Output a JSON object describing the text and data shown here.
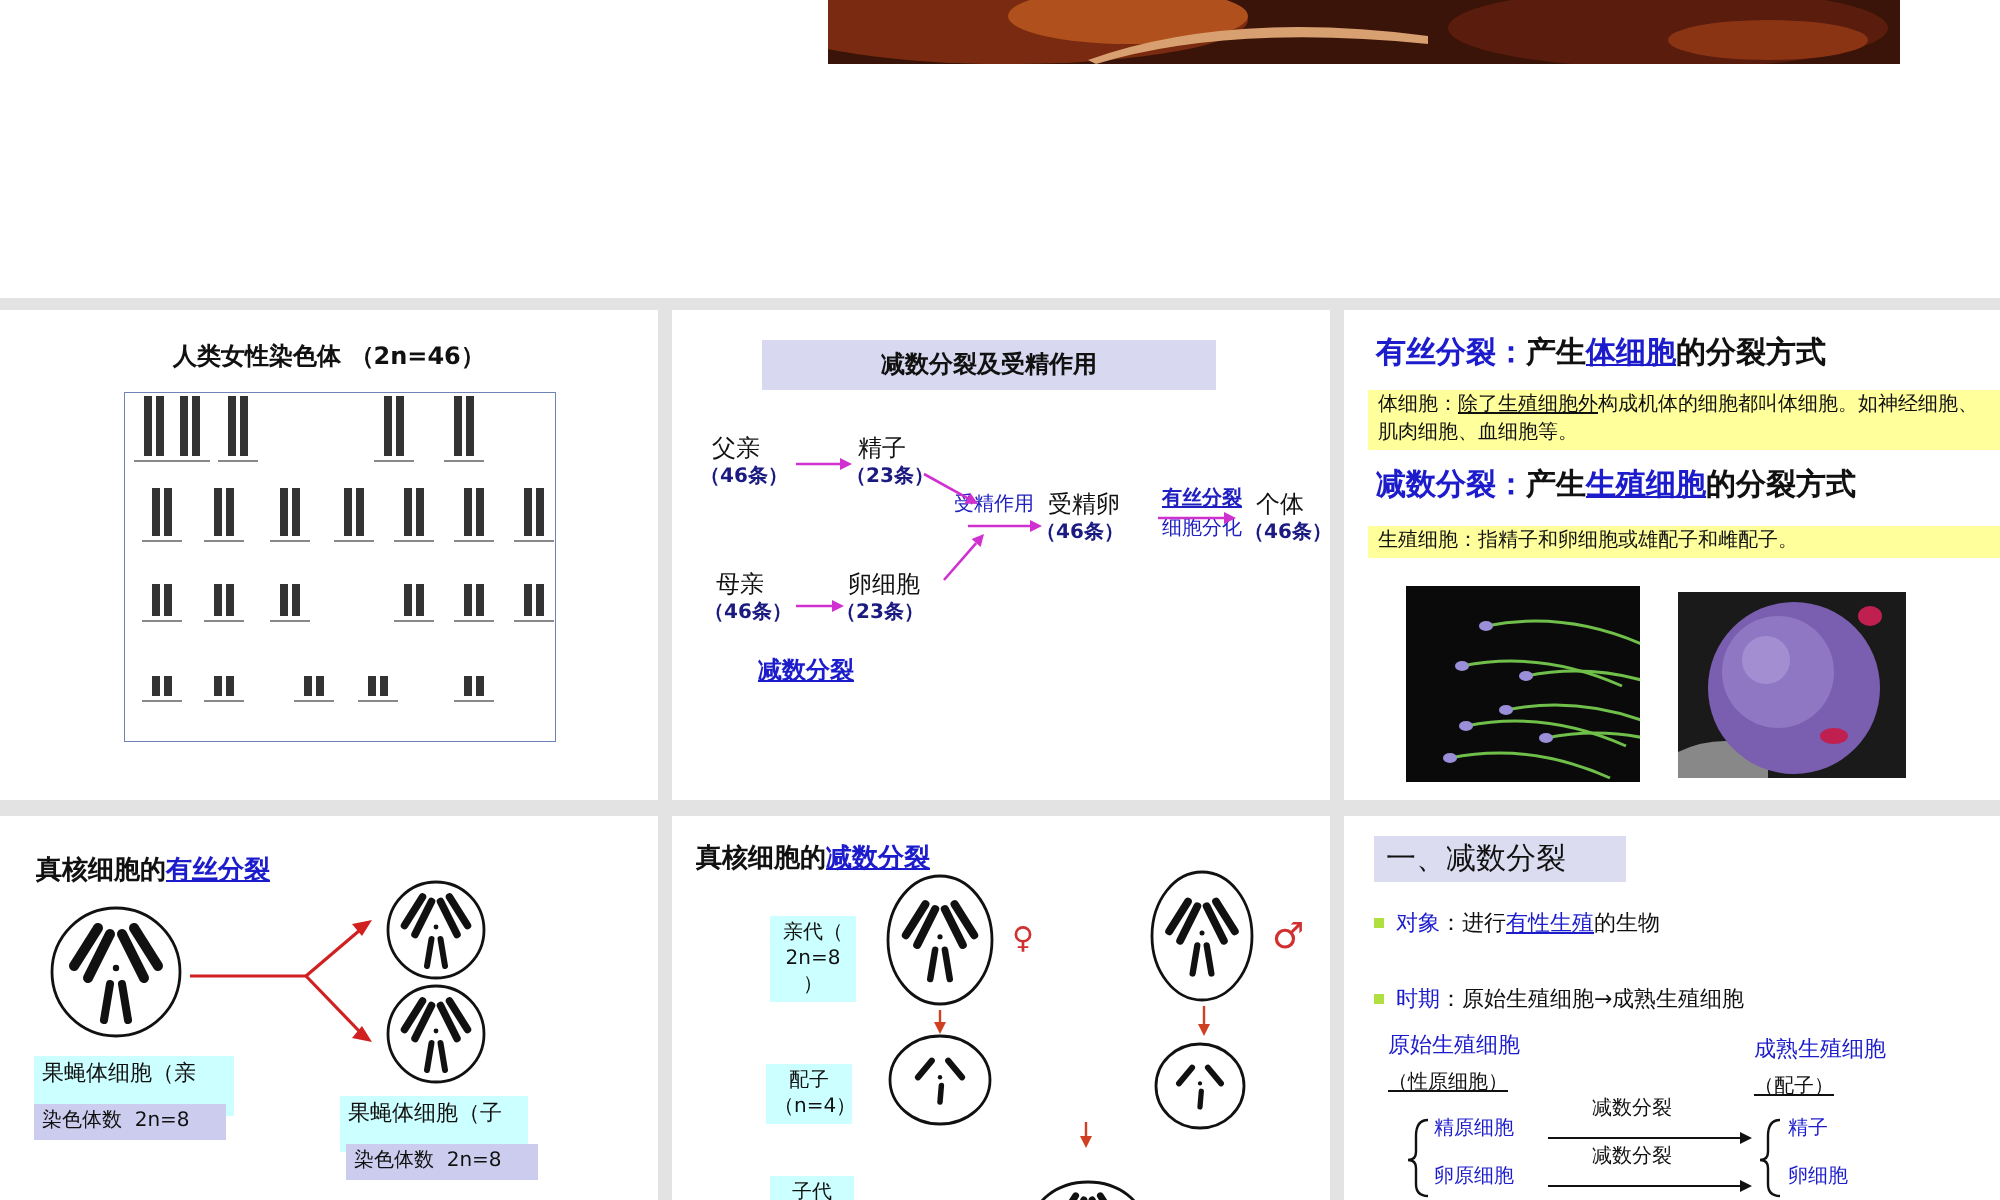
{
  "slides": [
    {
      "kind": "karyotype",
      "title": "人类女性染色体 （2n=46）"
    },
    {
      "kind": "fertilization",
      "title": "减数分裂及受精作用",
      "nodes": [
        {
          "label": "父亲",
          "count": "（46条）"
        },
        {
          "label": "精子",
          "count": "（23条）"
        },
        {
          "label": "母亲",
          "count": "（46条）"
        },
        {
          "label": "卵细胞",
          "count": "（23条）"
        },
        {
          "label": "受精卵",
          "count": "（46条）"
        },
        {
          "label": "个体",
          "count": "（46条）"
        }
      ],
      "arrow_labels": [
        "受精作用",
        "有丝分裂",
        "细胞分化"
      ],
      "link": "减数分裂"
    },
    {
      "kind": "definitions",
      "items": [
        {
          "heading": {
            "term": "有丝分裂：",
            "verb": "产生",
            "link": "体细胞",
            "rest": "的分裂方式"
          },
          "note": {
            "label": "体细胞：",
            "underlined": "除了生殖细胞外",
            "rest": "构成机体的细胞都叫体细胞。如神经细胞、肌肉细胞、血细胞等。"
          }
        },
        {
          "heading": {
            "term": "减数分裂：",
            "verb": "产生",
            "link": "生殖细胞",
            "rest": "的分裂方式"
          },
          "note": {
            "label": "生殖细胞：指精子和卵细胞或雄配子和雌配子。"
          }
        }
      ]
    },
    {
      "kind": "mitosis",
      "title": {
        "text": "真核细胞的",
        "link": "有丝分裂"
      },
      "labels": [
        {
          "name": "果蝇体细胞（亲",
          "count": "染色体数  2n=8"
        },
        {
          "name": "果蝇体细胞（子",
          "count": "染色体数  2n=8"
        }
      ]
    },
    {
      "kind": "meiosis",
      "title": {
        "text": "真核细胞的",
        "link": "减数分裂"
      },
      "generations": [
        "亲代（ 2n=8 ）",
        "配子（n=4）",
        "子代"
      ],
      "symbols": [
        "♀",
        "♂"
      ]
    },
    {
      "kind": "outline",
      "title": "一、减数分裂",
      "bullets": [
        {
          "term": "对象",
          "text": "：进行",
          "link": "有性生殖",
          "rest": "的生物"
        },
        {
          "term": "时期",
          "text": "：原始生殖细胞→成熟生殖细胞"
        }
      ],
      "left": {
        "heading": "原始生殖细胞",
        "sub": "（性原细胞）"
      },
      "right": {
        "heading": "成熟生殖细胞",
        "sub": "（配子）"
      },
      "rows": [
        {
          "from": "精原细胞",
          "process": "减数分裂",
          "to": "精子"
        },
        {
          "from": "卵原细胞",
          "process": "减数分裂",
          "to": "卵细胞"
        }
      ]
    }
  ]
}
